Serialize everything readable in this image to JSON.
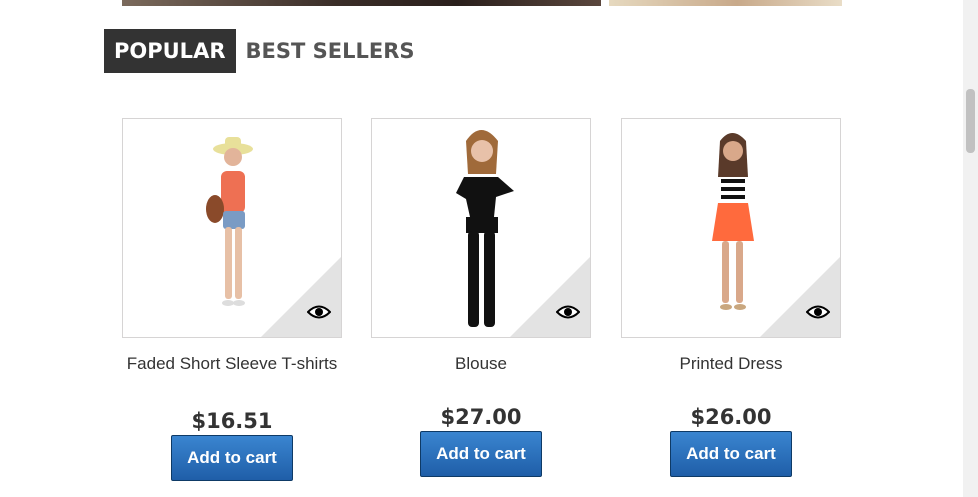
{
  "tabs": [
    {
      "label": "POPULAR",
      "active": true
    },
    {
      "label": "BEST SELLERS",
      "active": false
    }
  ],
  "products": [
    {
      "name": "Faded Short Sleeve T-shirts",
      "price": "$16.51",
      "button": "Add to cart",
      "quick_view_icon": "eye-icon"
    },
    {
      "name": "Blouse",
      "price": "$27.00",
      "button": "Add to cart",
      "quick_view_icon": "eye-icon"
    },
    {
      "name": "Printed Dress",
      "price": "$26.00",
      "button": "Add to cart",
      "quick_view_icon": "eye-icon"
    }
  ],
  "colors": {
    "tab_active_bg": "#333333",
    "button_blue": "#2b6fbd",
    "thumb_border": "#d6d4d4",
    "corner_gray": "#e3e3e3"
  }
}
